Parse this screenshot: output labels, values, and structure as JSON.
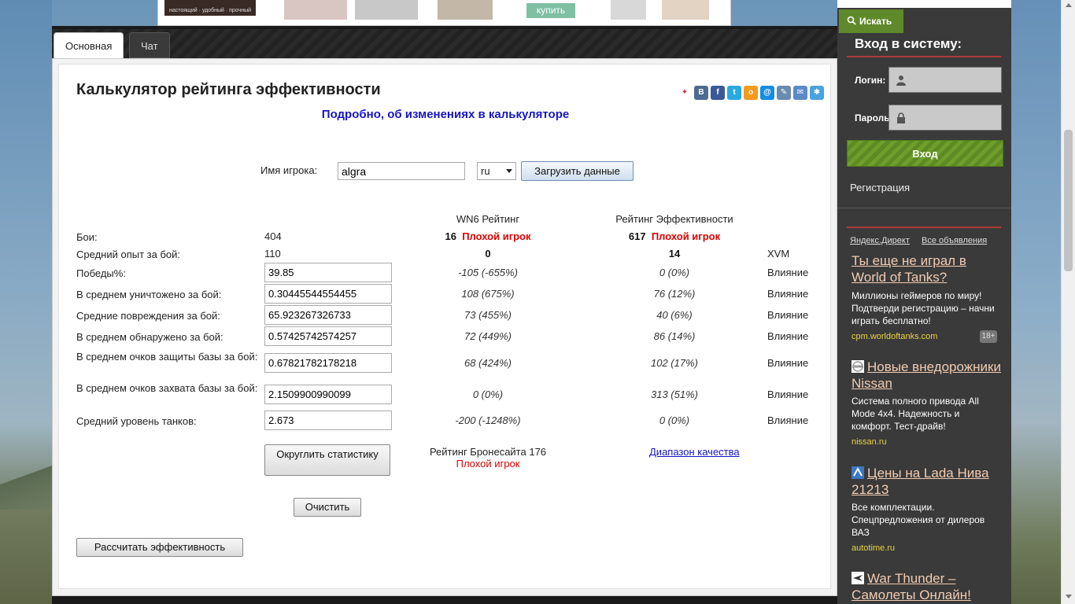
{
  "tabs": [
    {
      "label": "Основная"
    },
    {
      "label": "Чат"
    }
  ],
  "top_banner": {
    "logo_text": "настоящий · удобный · прочный",
    "buy_label": "купить"
  },
  "page": {
    "title": "Калькулятор рейтинга эффективности",
    "changes_link": "Подробно, об изменениях в калькуляторе"
  },
  "player": {
    "label": "Имя игрока:",
    "name_value": "algra",
    "server_value": "ru",
    "load_button": "Загрузить данные"
  },
  "headers": {
    "wn6": "WN6 Рейтинг",
    "eff": "Рейтинг Эффективности"
  },
  "battles": {
    "label": "Бои:",
    "value": "404",
    "wn6_value": "16",
    "wn6_grade": "Плохой игрок",
    "eff_value": "617",
    "eff_grade": "Плохой игрок"
  },
  "avg_exp": {
    "label": "Средний опыт за бой:",
    "value": "110",
    "wn6": "0",
    "eff": "14",
    "xvm": "XVM"
  },
  "rows": [
    {
      "label": "Победы%:",
      "value": "39.85",
      "wn6": "-105 (-655%)",
      "eff": "0 (0%)",
      "influence": "Влияние"
    },
    {
      "label": "В среднем уничтожено за бой:",
      "value": "0.30445544554455",
      "wn6": "108 (675%)",
      "eff": "76 (12%)",
      "influence": "Влияние"
    },
    {
      "label": "Средние повреждения за бой:",
      "value": "65.923267326733",
      "wn6": "73 (455%)",
      "eff": "40 (6%)",
      "influence": "Влияние"
    },
    {
      "label": "В среднем обнаружено за бой:",
      "value": "0.57425742574257",
      "wn6": "72 (449%)",
      "eff": "86 (14%)",
      "influence": "Влияние"
    },
    {
      "label": "В среднем очков защиты базы за бой:",
      "value": "0.67821782178218",
      "wn6": "68 (424%)",
      "eff": "102 (17%)",
      "influence": "Влияние"
    },
    {
      "label": "В среднем очков захвата базы за бой:",
      "value": "2.1509900990099",
      "wn6": "0 (0%)",
      "eff": "313 (51%)",
      "influence": "Влияние"
    },
    {
      "label": "Средний уровень танков:",
      "value": "2.673",
      "wn6": "-200 (-1248%)",
      "eff": "0 (0%)",
      "influence": "Влияние"
    }
  ],
  "actions": {
    "round_button": "Округлить статистику",
    "brone_label": "Рейтинг Бронесайта 176",
    "brone_grade": "Плохой игрок",
    "quality_link": "Диапазон качества",
    "clear_button": "Очистить",
    "calc_button": "Рассчитать эффективность"
  },
  "sidebar": {
    "search_button": "Искать",
    "login_title": "Вход в систему:",
    "login_label": "Логин:",
    "password_label": "Пароль:",
    "login_button": "Вход",
    "register_link": "Регистрация"
  },
  "ads": {
    "direct_label": "Яндекс.Директ",
    "all_ads_label": "Все объявления",
    "items": [
      {
        "title": "Ты еще не играл в World of Tanks?",
        "text": "Миллионы геймеров по миру! Подтверди регистрацию – начни играть бесплатно!",
        "domain": "cpm.worldoftanks.com",
        "badge": "18+"
      },
      {
        "title": "Новые внедорожники Nissan",
        "text": "Система полного привода All Mode 4x4. Надежность и комфорт. Тест-драйв!",
        "domain": "nissan.ru"
      },
      {
        "title": "Цены на Lada Нива 21213",
        "text": "Все комплектации. Спецпредложения от дилеров ВАЗ",
        "domain": "autotime.ru"
      },
      {
        "title": "War Thunder – Самолеты Онлайн!"
      }
    ]
  },
  "colors": {
    "link_blue": "#1515c8",
    "bad_red": "#e00000",
    "sidebar_bg": "#3a3a3a",
    "login_green": "#6e9e2b"
  }
}
